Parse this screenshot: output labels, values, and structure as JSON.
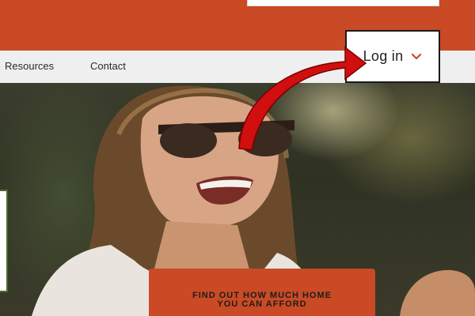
{
  "nav": {
    "items": [
      {
        "label": "Resources"
      },
      {
        "label": "Contact"
      }
    ]
  },
  "login": {
    "label": "Log in",
    "chevron_icon": "chevron-down-icon"
  },
  "cta": {
    "line1": "FIND OUT HOW MUCH HOME",
    "line2": "YOU CAN AFFORD"
  },
  "colors": {
    "brand_orange": "#c94a24",
    "nav_background": "#efefef",
    "annotation_arrow": "#d10f0f"
  }
}
